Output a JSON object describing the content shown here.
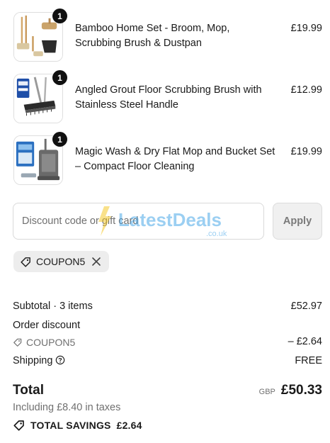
{
  "items": [
    {
      "name": "Bamboo Home Set - Broom, Mop, Scrubbing Brush & Dustpan",
      "price": "£19.99",
      "quantity": "1",
      "image_icon": "bamboo-cleaning-set-image"
    },
    {
      "name": "Angled Grout Floor Scrubbing Brush with Stainless Steel Handle",
      "price": "£12.99",
      "quantity": "1",
      "image_icon": "grout-scrubbing-brush-image"
    },
    {
      "name": "Magic Wash & Dry Flat Mop and Bucket Set – Compact Floor Cleaning",
      "price": "£19.99",
      "quantity": "1",
      "image_icon": "flat-mop-bucket-image"
    }
  ],
  "discount": {
    "placeholder": "Discount code or gift card",
    "value": "",
    "apply_label": "Apply"
  },
  "applied_coupon": {
    "code": "COUPON5"
  },
  "summary": {
    "subtotal_label": "Subtotal · 3 items",
    "subtotal_value": "£52.97",
    "order_discount_label": "Order discount",
    "order_discount_code": "COUPON5",
    "order_discount_value": "– £2.64",
    "shipping_label": "Shipping",
    "shipping_value": "FREE",
    "total_label": "Total",
    "currency": "GBP",
    "total_value": "£50.33",
    "taxes_text": "Including £8.40 in taxes",
    "savings_label": "TOTAL SAVINGS",
    "savings_value": "£2.64"
  },
  "watermark": {
    "text": "LatestDeals",
    "suffix": ".co.uk"
  },
  "colors": {
    "badge": "#111111",
    "muted_text": "#707070",
    "chip_bg": "#ededed",
    "button_bg": "#f0f0f0",
    "watermark_blue": "#3aa0e6",
    "watermark_yellow": "#f5c518"
  }
}
